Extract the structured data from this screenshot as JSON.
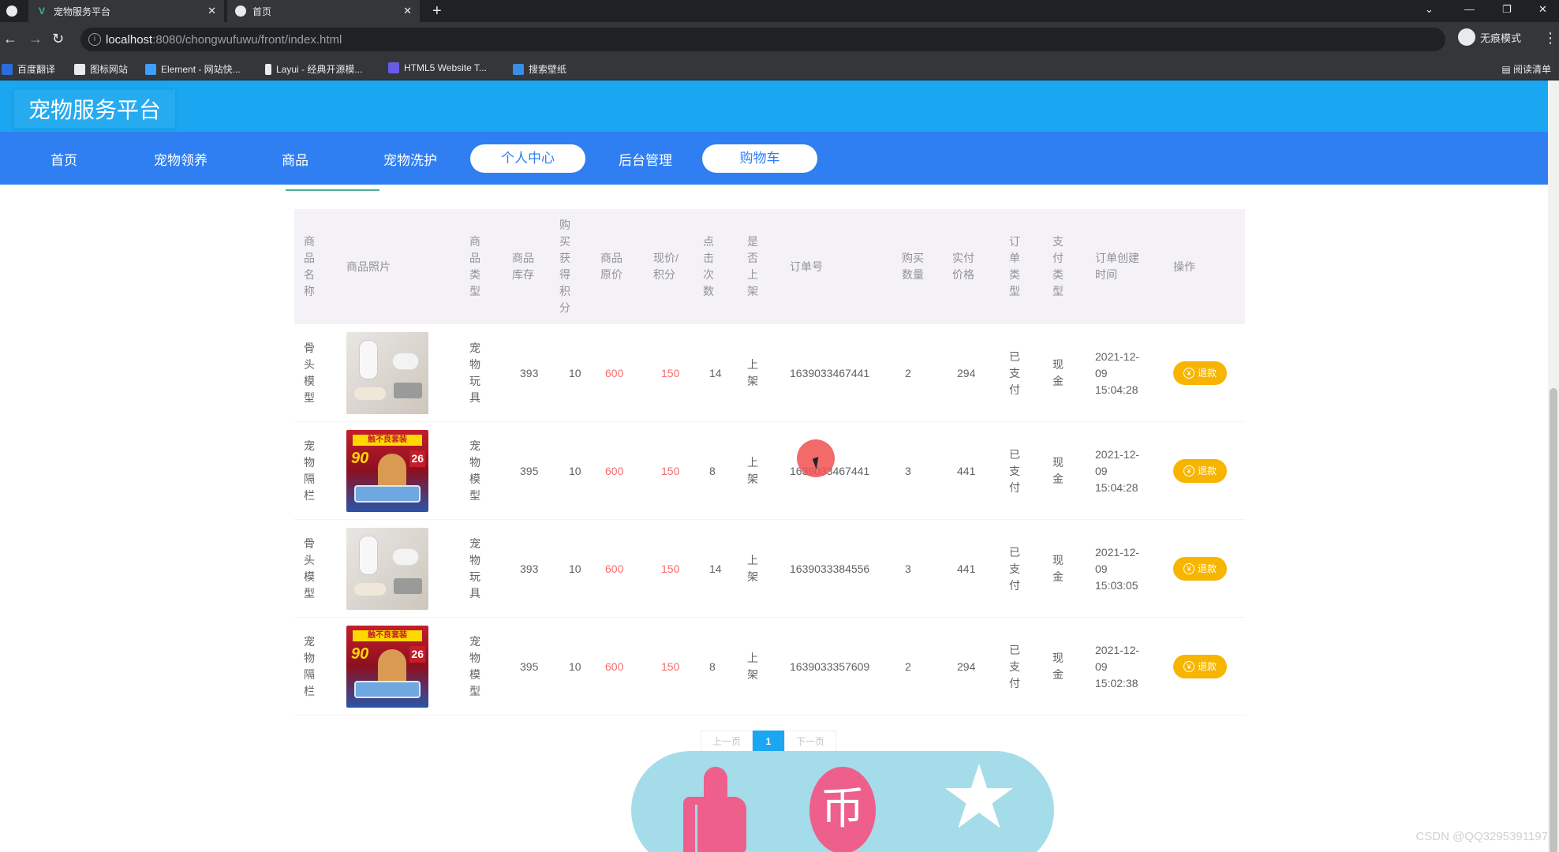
{
  "browser": {
    "tabs": [
      {
        "title": "宠物服务平台",
        "icon": "vue-icon"
      },
      {
        "title": "首页",
        "icon": "globe-icon"
      }
    ],
    "url_host": "localhost",
    "url_rest": ":8080/chongwufuwu/front/index.html",
    "incognito_label": "无痕模式",
    "bookmarks": [
      {
        "label": "百度翻译",
        "color": "#2d6cdf"
      },
      {
        "label": "图标网站",
        "color": "#ffffff"
      },
      {
        "label": "Element - 网站快...",
        "color": "#409eff"
      },
      {
        "label": "Layui - 经典开源模...",
        "color": "#ffffff"
      },
      {
        "label": "HTML5 Website T...",
        "color": "#6b5ce7"
      },
      {
        "label": "搜索壁纸",
        "color": "#3a8ee6"
      }
    ],
    "reading_list": "阅读清单"
  },
  "site": {
    "title": "宠物服务平台",
    "nav": [
      "首页",
      "宠物领养",
      "商品",
      "宠物洗护",
      "个人中心",
      "后台管理",
      "购物车"
    ]
  },
  "table": {
    "headers": [
      "商\n品\n名\n称",
      "商品照片",
      "商\n品\n类\n型",
      "商品\n库存",
      "购\n买\n获\n得\n积\n分",
      "商品\n原价",
      "现价/\n积分",
      "点\n击\n次\n数",
      "是\n否\n上\n架",
      "订单号",
      "购买\n数量",
      "实付\n价格",
      "订\n单\n类\n型",
      "支\n付\n类\n型",
      "订单创建\n时间",
      "操作"
    ],
    "rows": [
      {
        "name": "骨\n头\n模\n型",
        "img": "bone",
        "type": "宠\n物\n玩\n具",
        "stock": "393",
        "points": "10",
        "orig": "600",
        "now": "150",
        "clicks": "14",
        "shelf": "上\n架",
        "order": "1639033467441",
        "qty": "2",
        "paid": "294",
        "otype": "已\n支\n付",
        "ptype": "现\n金",
        "time": "2021-12-\n09\n15:04:28",
        "action": "退款"
      },
      {
        "name": "宠\n物\n隔\n栏",
        "img": "pet",
        "type": "宠\n物\n模\n型",
        "stock": "395",
        "points": "10",
        "orig": "600",
        "now": "150",
        "clicks": "8",
        "shelf": "上\n架",
        "order": "1639033467441",
        "qty": "3",
        "paid": "441",
        "otype": "已\n支\n付",
        "ptype": "现\n金",
        "time": "2021-12-\n09\n15:04:28",
        "action": "退款"
      },
      {
        "name": "骨\n头\n模\n型",
        "img": "bone",
        "type": "宠\n物\n玩\n具",
        "stock": "393",
        "points": "10",
        "orig": "600",
        "now": "150",
        "clicks": "14",
        "shelf": "上\n架",
        "order": "1639033384556",
        "qty": "3",
        "paid": "441",
        "otype": "已\n支\n付",
        "ptype": "现\n金",
        "time": "2021-12-\n09\n15:03:05",
        "action": "退款"
      },
      {
        "name": "宠\n物\n隔\n栏",
        "img": "pet",
        "type": "宠\n物\n模\n型",
        "stock": "395",
        "points": "10",
        "orig": "600",
        "now": "150",
        "clicks": "8",
        "shelf": "上\n架",
        "order": "1639033357609",
        "qty": "2",
        "paid": "294",
        "otype": "已\n支\n付",
        "ptype": "现\n金",
        "time": "2021-12-\n09\n15:02:38",
        "action": "退款"
      }
    ]
  },
  "pager": {
    "prev": "上一页",
    "current": "1",
    "next": "下一页"
  },
  "pet_img": {
    "banner": "触不良套装",
    "big": "90",
    "price": "26"
  },
  "float_panel": {
    "coin_glyph": "币"
  },
  "watermark": "CSDN @QQ3295391197",
  "colors": {
    "header": "#1aa6f0",
    "nav": "#2f7ff2",
    "refund": "#f7b500",
    "accent_red": "#f56c6c",
    "panel": "#a4dcea",
    "panel_icons": "#ee5f8b"
  }
}
